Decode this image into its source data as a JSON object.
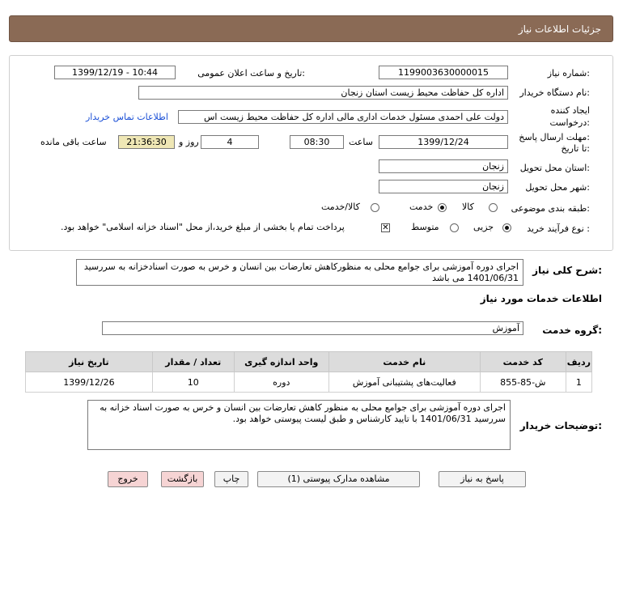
{
  "header": {
    "title": "جزئیات اطلاعات نیاز"
  },
  "form": {
    "need_number_label": "شماره نیاز:",
    "need_number": "1199003630000015",
    "announce_label": "تاریخ و ساعت اعلان عمومی:",
    "announce_value": "1399/12/19 - 10:44",
    "buyer_label": "نام دستگاه خریدار:",
    "buyer_value": "اداره کل حفاظت محیط زیست استان زنجان",
    "creator_label_1": "ایجاد کننده",
    "creator_label_2": "درخواست:",
    "creator_value": "دولت علی احمدی مسئول خدمات اداری مالی اداره کل حفاظت محیط زیست اس",
    "contact_link": "اطلاعات تماس خریدار",
    "deadline_label_1": "مهلت ارسال پاسخ:",
    "deadline_label_2": "تا تاریخ:",
    "deadline_date": "1399/12/24",
    "time_label": "ساعت",
    "deadline_time": "08:30",
    "days_value": "4",
    "days_label": "روز و",
    "remaining_value": "21:36:30",
    "remaining_label": "ساعت باقی مانده",
    "province_label": "استان محل تحویل:",
    "province_value": "زنجان",
    "city_label": "شهر محل تحویل:",
    "city_value": "زنجان",
    "category_label": "طبقه بندی موضوعی:",
    "category_options": [
      "کالا",
      "خدمت",
      "کالا/خدمت"
    ],
    "category_selected": "خدمت",
    "process_label": "نوع فرآیند خرید :",
    "process_options": [
      "جزیی",
      "متوسط"
    ],
    "process_selected": "جزیی",
    "payment_note": "پرداخت تمام یا بخشی از مبلغ خرید،از محل \"اسناد خزانه اسلامی\" خواهد بود."
  },
  "summary": {
    "label": "شرح کلی نیاز:",
    "text": "اجرای دوره آموزشی برای جوامع محلی به منظورکاهش تعارضات بین انسان و خرس به صورت اسنادخزانه به سررسید 1401/06/31 می باشد"
  },
  "services": {
    "section_title": "اطلاعات خدمات مورد نیاز",
    "group_label": "گروه خدمت:",
    "group_value": "آموزش",
    "columns": [
      "ردیف",
      "کد خدمت",
      "نام خدمت",
      "واحد اندازه گیری",
      "تعداد / مقدار",
      "تاریخ نیاز"
    ],
    "rows": [
      {
        "index": "1",
        "code": "ش-85-855",
        "name": "فعالیت‌های پشتیبانی آموزش",
        "unit": "دوره",
        "qty": "10",
        "date": "1399/12/26"
      }
    ]
  },
  "buyer_notes": {
    "label": "توضیحات خریدار:",
    "text": "اجرای دوره آموزشی برای جوامع محلی به منظور کاهش تعارضات بین انسان و خرس به صورت اسناد خزانه به سررسید 1401/06/31 با تایید کارشناس و طبق لیست پیوستی خواهد بود."
  },
  "buttons": {
    "reply": "پاسخ به نیاز",
    "attachments": "مشاهده مدارک پیوستی (1)",
    "print": "چاپ",
    "back": "بازگشت",
    "exit": "خروج"
  }
}
